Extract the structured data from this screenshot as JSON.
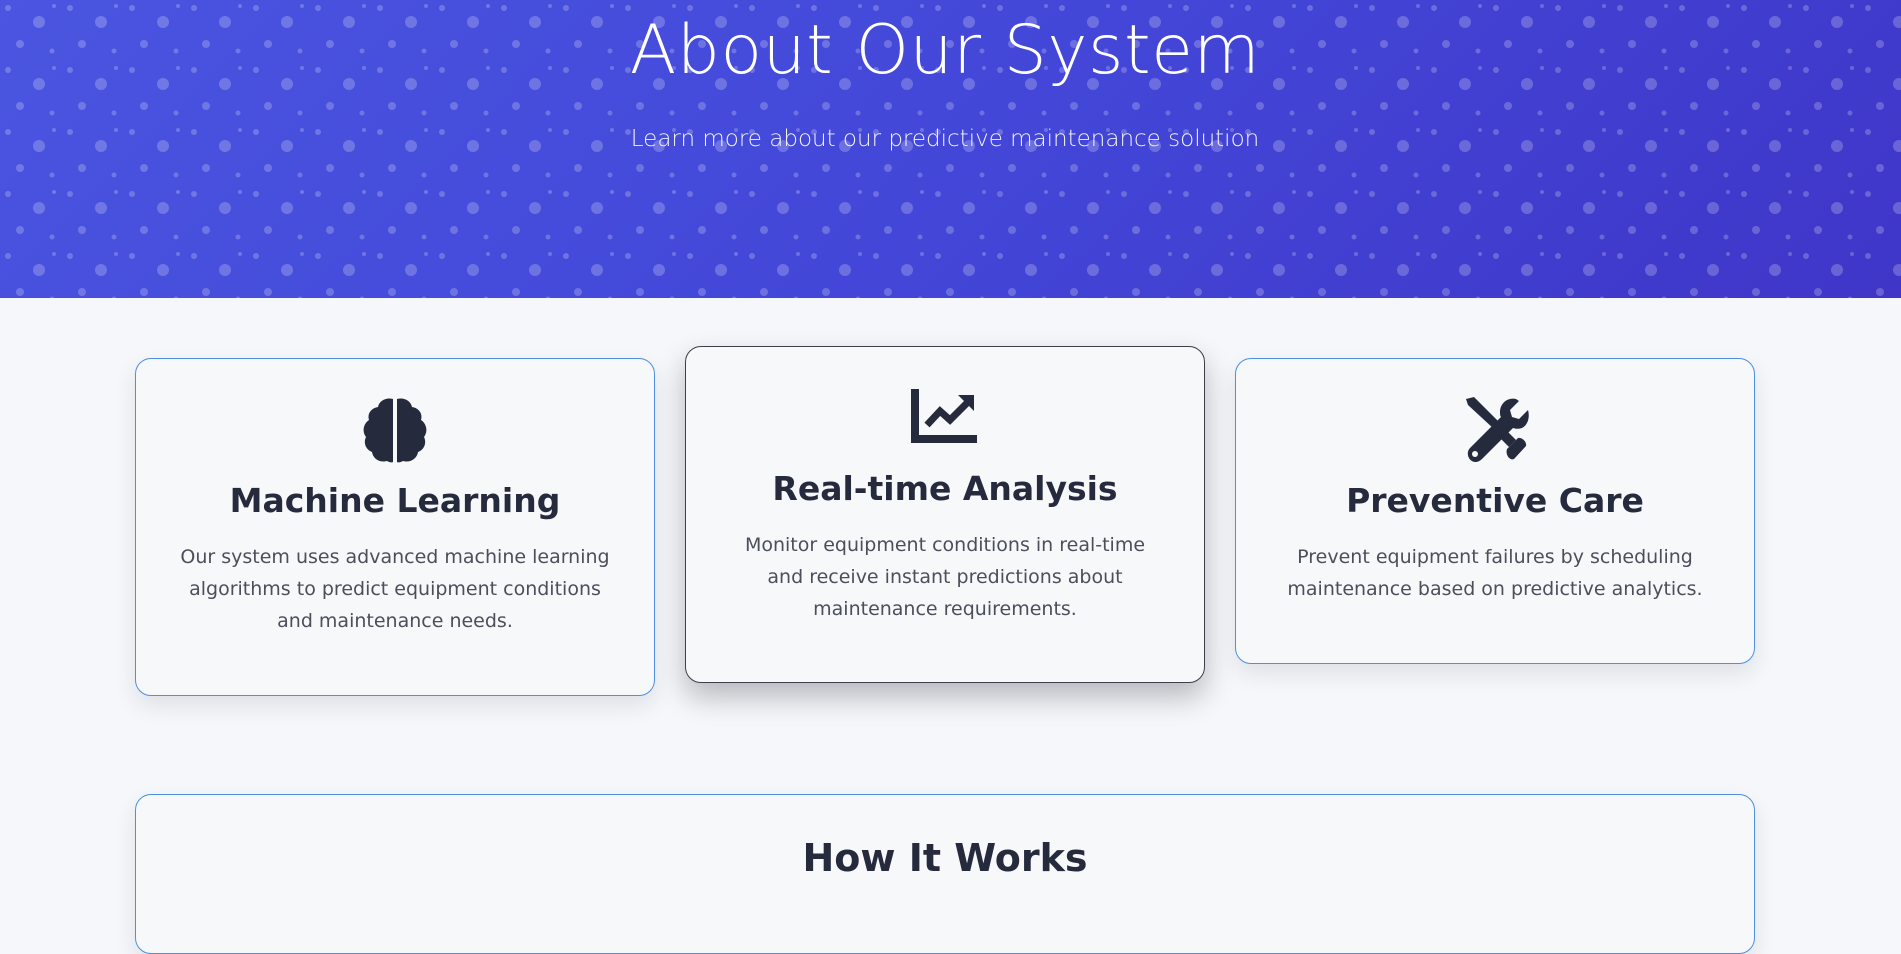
{
  "hero": {
    "title": "About Our System",
    "subtitle": "Learn more about our predictive maintenance solution",
    "colors": {
      "gradient_start": "#4a55e0",
      "gradient_end": "#3f36c8"
    }
  },
  "features": [
    {
      "icon": "brain-icon",
      "title": "Machine Learning",
      "description": "Our system uses advanced machine learning algorithms to predict equipment conditions and maintenance needs."
    },
    {
      "icon": "chart-line-icon",
      "title": "Real-time Analysis",
      "description": "Monitor equipment conditions in real-time and receive instant predictions about maintenance requirements."
    },
    {
      "icon": "tools-icon",
      "title": "Preventive Care",
      "description": "Prevent equipment failures by scheduling maintenance based on predictive analytics."
    }
  ],
  "how_it_works": {
    "title": "How It Works"
  },
  "colors": {
    "card_border": "#4d90e0",
    "heading_text": "#262a3d",
    "body_text": "#4b4f5c",
    "page_background": "#f5f7fa"
  }
}
